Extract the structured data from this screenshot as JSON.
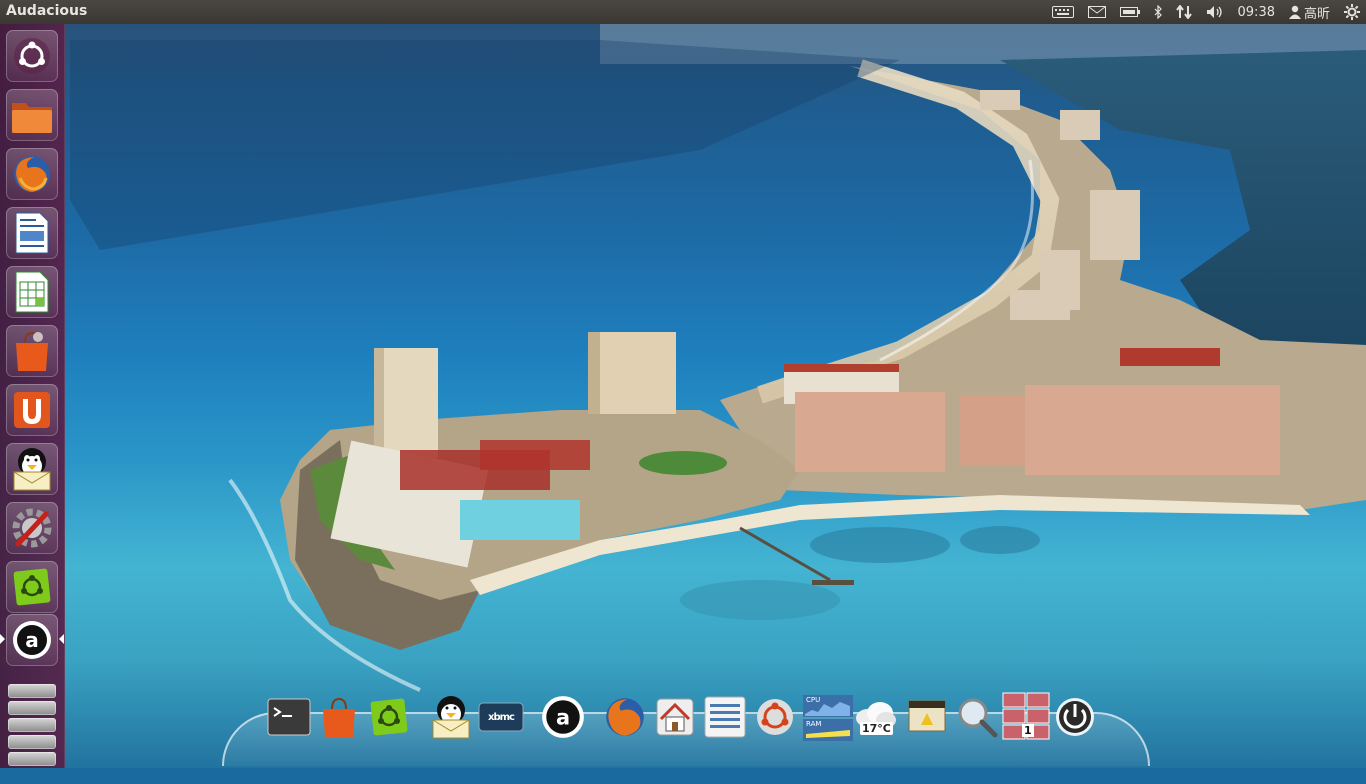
{
  "top_panel": {
    "app_title": "Audacious",
    "clock": "09:38",
    "user_name": "高昕",
    "indicators": [
      "keyboard-icon",
      "mail-icon",
      "battery-icon",
      "bluetooth-icon",
      "network-icon",
      "volume-icon",
      "user-icon",
      "gear-icon"
    ]
  },
  "launcher": {
    "items": [
      {
        "name": "dash-home",
        "icon": "ubuntu-logo-icon"
      },
      {
        "name": "files",
        "icon": "folder-icon"
      },
      {
        "name": "firefox",
        "icon": "firefox-icon"
      },
      {
        "name": "libreoffice-writer",
        "icon": "writer-icon"
      },
      {
        "name": "libreoffice-calc",
        "icon": "calc-icon"
      },
      {
        "name": "software-center",
        "icon": "shopping-bag-icon"
      },
      {
        "name": "ubuntu-one",
        "icon": "ubuntu-one-icon"
      },
      {
        "name": "pidgin-messenger",
        "icon": "penguin-mail-icon"
      },
      {
        "name": "system-settings",
        "icon": "settings-tools-icon"
      },
      {
        "name": "ubuntu-tweak",
        "icon": "ubuntu-green-icon"
      },
      {
        "name": "audacious",
        "icon": "audacious-icon",
        "active": true
      }
    ]
  },
  "dock": {
    "items": [
      {
        "name": "terminal",
        "icon": "terminal-icon"
      },
      {
        "name": "software-center",
        "icon": "shopping-bag-icon"
      },
      {
        "name": "ubuntu-tweak",
        "icon": "ubuntu-green-icon"
      },
      {
        "name": "pidgin",
        "icon": "penguin-mail-icon"
      },
      {
        "name": "xbmc",
        "icon": "xbmc-icon",
        "label": "xbmc"
      },
      {
        "name": "audacious",
        "icon": "audacious-icon"
      },
      {
        "name": "firefox",
        "icon": "firefox-icon"
      },
      {
        "name": "home-folder",
        "icon": "home-icon"
      },
      {
        "name": "file-manager",
        "icon": "file-list-icon"
      },
      {
        "name": "ubuntu-software",
        "icon": "ubuntu-red-icon"
      },
      {
        "name": "system-monitor",
        "icon": "cpu-ram-monitor-icon",
        "cpu_label": "CPU",
        "ram_label": "RAM"
      },
      {
        "name": "weather",
        "icon": "weather-cloud-icon",
        "temperature": "17°C"
      },
      {
        "name": "notes",
        "icon": "notes-icon"
      },
      {
        "name": "search",
        "icon": "magnifier-icon"
      },
      {
        "name": "workspace-switcher",
        "icon": "workspace-icon",
        "workspace": "1"
      },
      {
        "name": "shutdown",
        "icon": "power-icon"
      }
    ]
  }
}
